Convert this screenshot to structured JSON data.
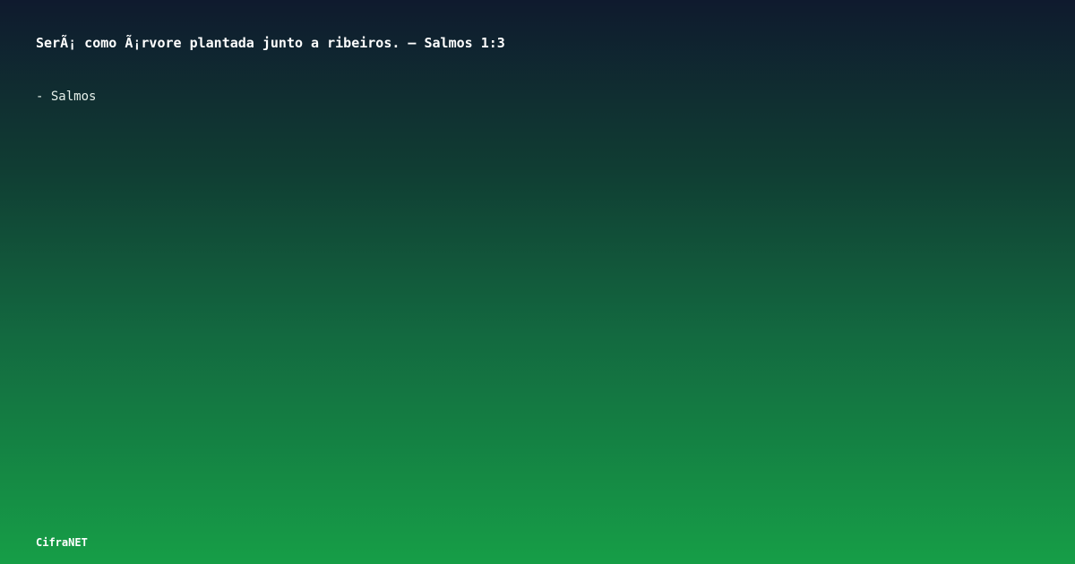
{
  "card": {
    "quote": "SerÃ¡ como Ã¡rvore plantada junto a ribeiros. — Salmos 1:3",
    "attribution": "- Salmos",
    "brand": "CifraNET"
  },
  "colors": {
    "gradient_top": "#0f1a2e",
    "gradient_bottom": "#169e47",
    "text": "#ffffff"
  }
}
